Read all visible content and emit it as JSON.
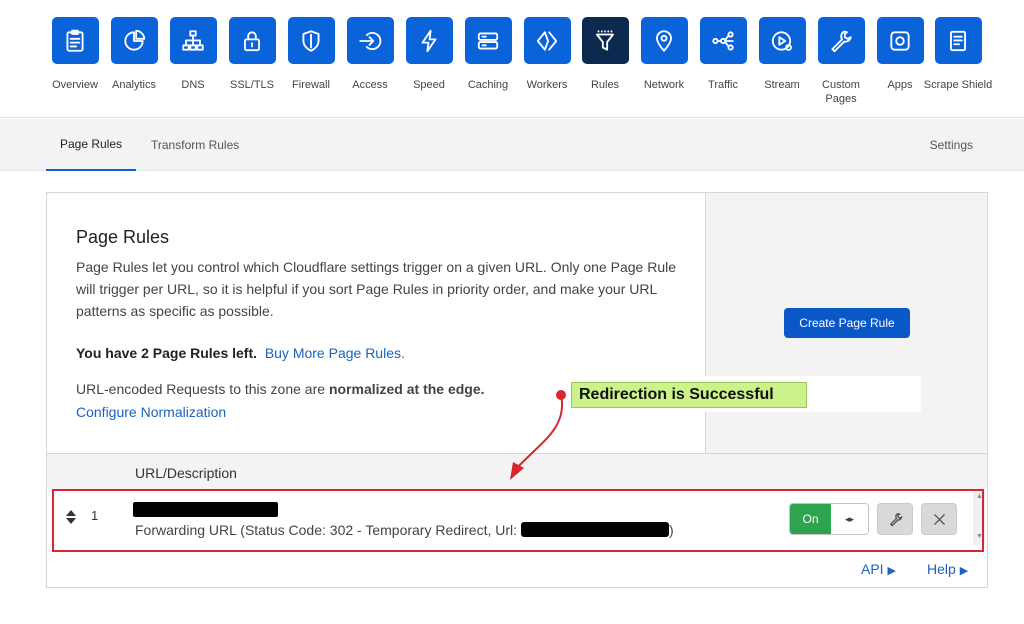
{
  "nav": {
    "items": [
      {
        "label": "Overview"
      },
      {
        "label": "Analytics"
      },
      {
        "label": "DNS"
      },
      {
        "label": "SSL/TLS"
      },
      {
        "label": "Firewall"
      },
      {
        "label": "Access"
      },
      {
        "label": "Speed"
      },
      {
        "label": "Caching"
      },
      {
        "label": "Workers"
      },
      {
        "label": "Rules"
      },
      {
        "label": "Network"
      },
      {
        "label": "Traffic"
      },
      {
        "label": "Stream"
      },
      {
        "label": "Custom Pages"
      },
      {
        "label": "Apps"
      },
      {
        "label": "Scrape Shield"
      }
    ],
    "active": "Rules"
  },
  "tabs": {
    "page_rules": "Page Rules",
    "transform_rules": "Transform Rules",
    "settings": "Settings"
  },
  "card": {
    "title": "Page Rules",
    "description": "Page Rules let you control which Cloudflare settings trigger on a given URL. Only one Page Rule will trigger per URL, so it is helpful if you sort Page Rules in priority order, and make your URL patterns as specific as possible.",
    "rules_left": "You have 2 Page Rules left.",
    "buy_more": "Buy More Page Rules.",
    "normalized_prefix": "URL-encoded Requests to this zone are ",
    "normalized_bold": "normalized at the edge.",
    "configure_link": "Configure Normalization",
    "create_button": "Create Page Rule"
  },
  "annotation": {
    "label": "Redirection is Successful"
  },
  "table": {
    "header": "URL/Description",
    "rows": [
      {
        "number": "1",
        "description_prefix": "Forwarding URL (Status Code: 302 - Temporary Redirect, Url:",
        "description_suffix": ")",
        "toggle": "On"
      }
    ]
  },
  "footer": {
    "api": "API",
    "help": "Help"
  },
  "colors": {
    "brand_blue": "#0a63d8",
    "active_nav": "#0c2a4f",
    "toggle_green": "#2ea44f",
    "highlight_red": "#d9262e",
    "annotation_green": "#ccf28a"
  }
}
